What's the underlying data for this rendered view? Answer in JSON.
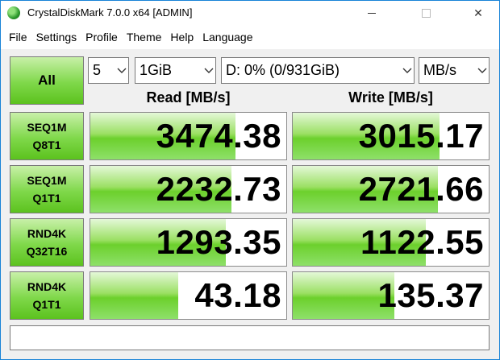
{
  "window": {
    "title": "CrystalDiskMark 7.0.0 x64 [ADMIN]",
    "controls": {
      "close_glyph": "✕"
    }
  },
  "menu": [
    "File",
    "Settings",
    "Profile",
    "Theme",
    "Help",
    "Language"
  ],
  "toolbar": {
    "all_label": "All",
    "count": "5",
    "size": "1GiB",
    "drive": "D: 0% (0/931GiB)",
    "unit": "MB/s"
  },
  "headers": {
    "read": "Read [MB/s]",
    "write": "Write [MB/s]"
  },
  "rows": [
    {
      "line1": "SEQ1M",
      "line2": "Q8T1",
      "read": "3474.38",
      "write": "3015.17",
      "read_fill": 0.74,
      "write_fill": 0.75
    },
    {
      "line1": "SEQ1M",
      "line2": "Q1T1",
      "read": "2232.73",
      "write": "2721.66",
      "read_fill": 0.72,
      "write_fill": 0.74
    },
    {
      "line1": "RND4K",
      "line2": "Q32T16",
      "read": "1293.35",
      "write": "1122.55",
      "read_fill": 0.69,
      "write_fill": 0.68
    },
    {
      "line1": "RND4K",
      "line2": "Q1T1",
      "read": "43.18",
      "write": "135.37",
      "read_fill": 0.45,
      "write_fill": 0.52
    }
  ],
  "colors": {
    "accent_green": "#6cd02c",
    "window_border": "#1883d7",
    "panel_bg": "#f0f0f0"
  },
  "status_text": ""
}
